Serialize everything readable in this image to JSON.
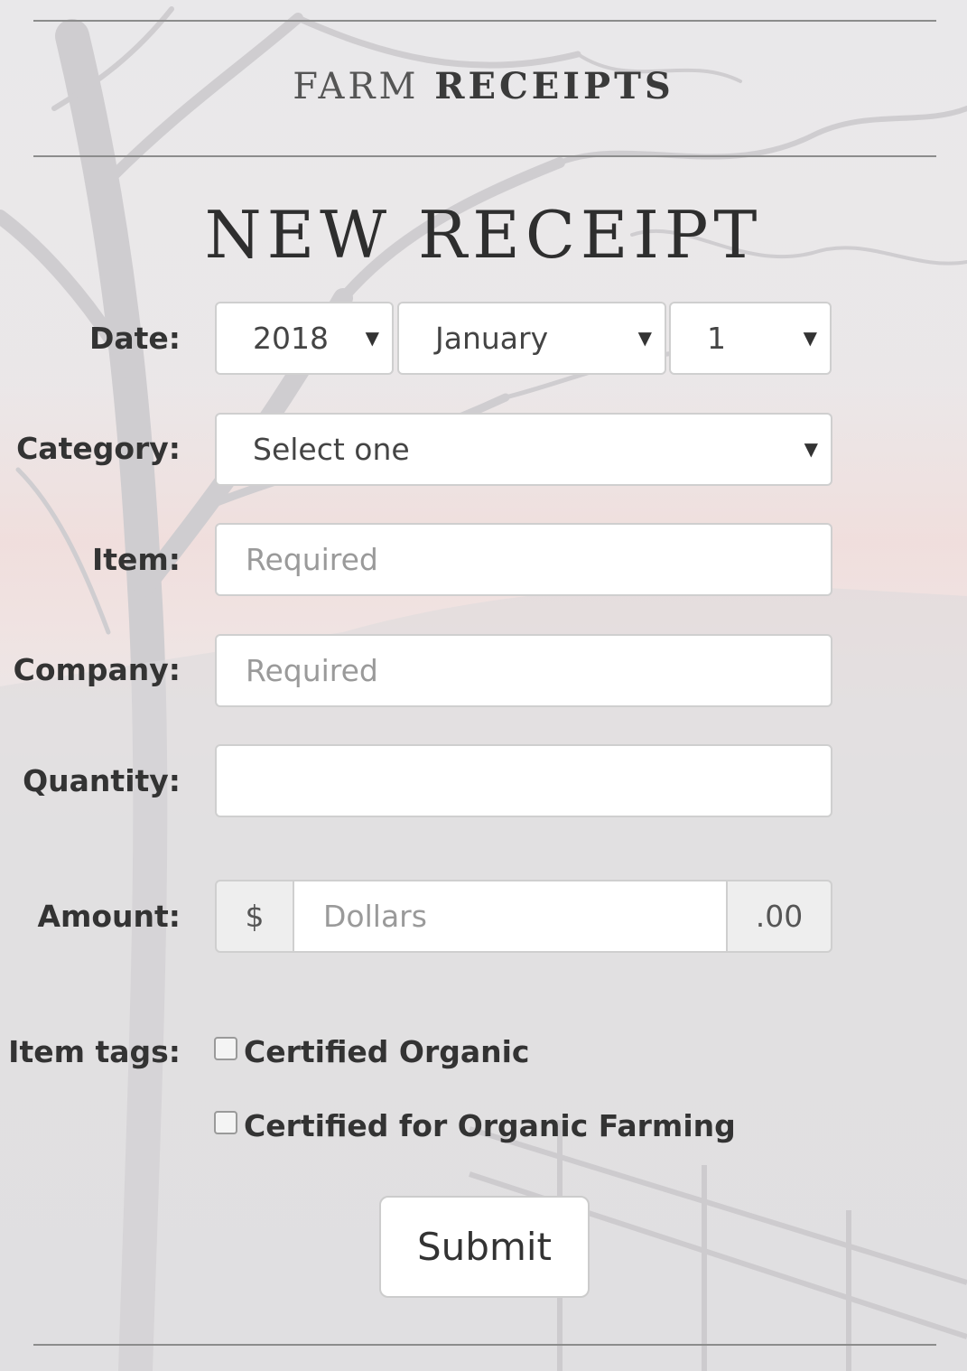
{
  "header": {
    "brand_light": "FARM",
    "brand_bold": "RECEIPTS"
  },
  "form": {
    "title": "NEW RECEIPT",
    "date": {
      "label": "Date:",
      "year": "2018",
      "month": "January",
      "day": "1"
    },
    "category": {
      "label": "Category:",
      "selected": "Select one"
    },
    "item": {
      "label": "Item:",
      "placeholder": "Required",
      "value": ""
    },
    "company": {
      "label": "Company:",
      "placeholder": "Required",
      "value": ""
    },
    "quantity": {
      "label": "Quantity:",
      "value": ""
    },
    "amount": {
      "label": "Amount:",
      "prefix": "$",
      "placeholder": "Dollars",
      "suffix": ".00"
    },
    "tags": {
      "label": "Item tags:",
      "options": [
        {
          "label": "Certified Organic",
          "checked": false
        },
        {
          "label": "Certified for Organic Farming",
          "checked": false
        }
      ]
    },
    "submit_label": "Submit"
  },
  "icons": {
    "caret": "chevron-down-icon"
  },
  "colors": {
    "rule": "#8c8c8c",
    "input_border": "#cfcfcf",
    "addon_bg": "#eeeeee",
    "text": "#333333"
  }
}
